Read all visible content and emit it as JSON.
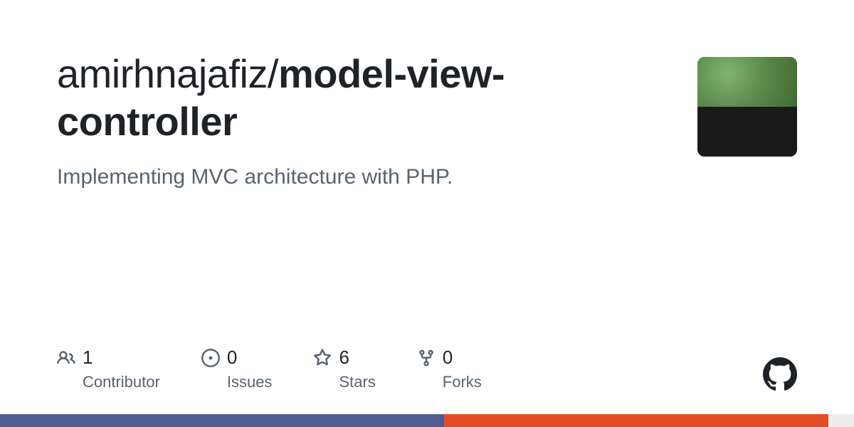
{
  "owner": "amirhnajafiz",
  "repo": "model-view-controller",
  "description": "Implementing MVC architecture with PHP.",
  "stats": {
    "contributors": {
      "count": "1",
      "label": "Contributor"
    },
    "issues": {
      "count": "0",
      "label": "Issues"
    },
    "stars": {
      "count": "6",
      "label": "Stars"
    },
    "forks": {
      "count": "0",
      "label": "Forks"
    }
  },
  "languages": {
    "blue_pct": "52%",
    "red_pct": "45%",
    "grey_pct": "3%"
  }
}
